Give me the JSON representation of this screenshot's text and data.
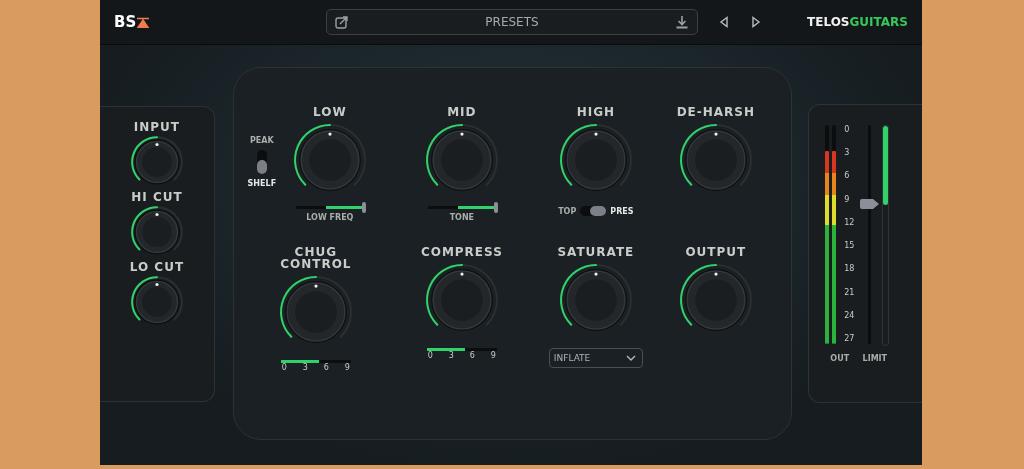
{
  "header": {
    "logo": "BS",
    "presets": {
      "label": "PRESETS"
    },
    "brand": {
      "name": "TELOS",
      "tagline": "GUITARS"
    }
  },
  "side_panel": {
    "knobs": [
      {
        "label": "INPUT",
        "level": 0.5
      },
      {
        "label": "HI CUT",
        "level": 0.5
      },
      {
        "label": "LO CUT",
        "level": 0.5
      }
    ]
  },
  "main_panel": {
    "eq_mode": [
      {
        "label": "PEAK",
        "selected": false
      },
      {
        "label": "SHELF",
        "selected": true
      }
    ],
    "controls": [
      {
        "kind": "slider",
        "label": "LOW",
        "level": 0.5,
        "slider": {
          "label": "LOW FREQ",
          "level": 0.55
        }
      },
      {
        "kind": "slider",
        "label": "MID",
        "level": 0.5,
        "slider": {
          "label": "TONE",
          "level": 0.55
        }
      },
      {
        "kind": "switch",
        "label": "HIGH",
        "level": 0.5,
        "options": [
          {
            "label": "TOP",
            "selected": false
          },
          {
            "label": "PRES",
            "selected": true
          }
        ]
      },
      {
        "kind": "plain",
        "label": "DE-HARSH",
        "level": 0.5
      },
      {
        "kind": "meter",
        "label": "CHUG\nCONTROL",
        "level": 0.5,
        "meter": {
          "level": 0.55,
          "ticks": [
            "0",
            "3",
            "6",
            "9"
          ]
        }
      },
      {
        "kind": "meter",
        "label": "COMPRESS",
        "level": 0.5,
        "meter": {
          "level": 0.55,
          "ticks": [
            "0",
            "3",
            "6",
            "9"
          ]
        }
      },
      {
        "kind": "dropdown",
        "label": "SATURATE",
        "level": 0.5,
        "dropdown": {
          "value": "INFLATE"
        }
      },
      {
        "kind": "plain",
        "label": "OUTPUT",
        "level": 0.5
      }
    ]
  },
  "output_meter": {
    "label": "OUT",
    "channels": [
      {
        "level": 0.88
      },
      {
        "level": 0.88
      }
    ],
    "scale": [
      "0",
      "3",
      "6",
      "9",
      "12",
      "15",
      "18",
      "21",
      "24",
      "27"
    ]
  },
  "limiter": {
    "label": "LIMIT",
    "level": 0.64
  }
}
